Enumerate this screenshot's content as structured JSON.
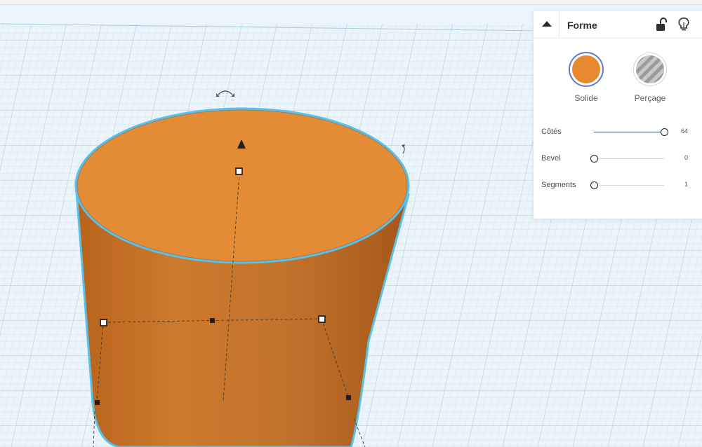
{
  "panel": {
    "title": "Forme",
    "icons": {
      "collapse": "caret-up-icon",
      "lock": "unlock-icon",
      "visibility": "lightbulb-icon"
    },
    "modes": [
      {
        "label": "Solide",
        "selected": true,
        "color": "#E7892E"
      },
      {
        "label": "Perçage",
        "selected": false
      }
    ],
    "properties": [
      {
        "label": "Côtés",
        "value": "64",
        "level": 1.0
      },
      {
        "label": "Bevel",
        "value": "0",
        "level": 0.0
      },
      {
        "label": "Segments",
        "value": "1",
        "level": 0.0
      }
    ]
  },
  "colors": {
    "shape": "#E7892E",
    "selection_outline": "#59C0E8",
    "grid_background": "#EAF4FA"
  }
}
